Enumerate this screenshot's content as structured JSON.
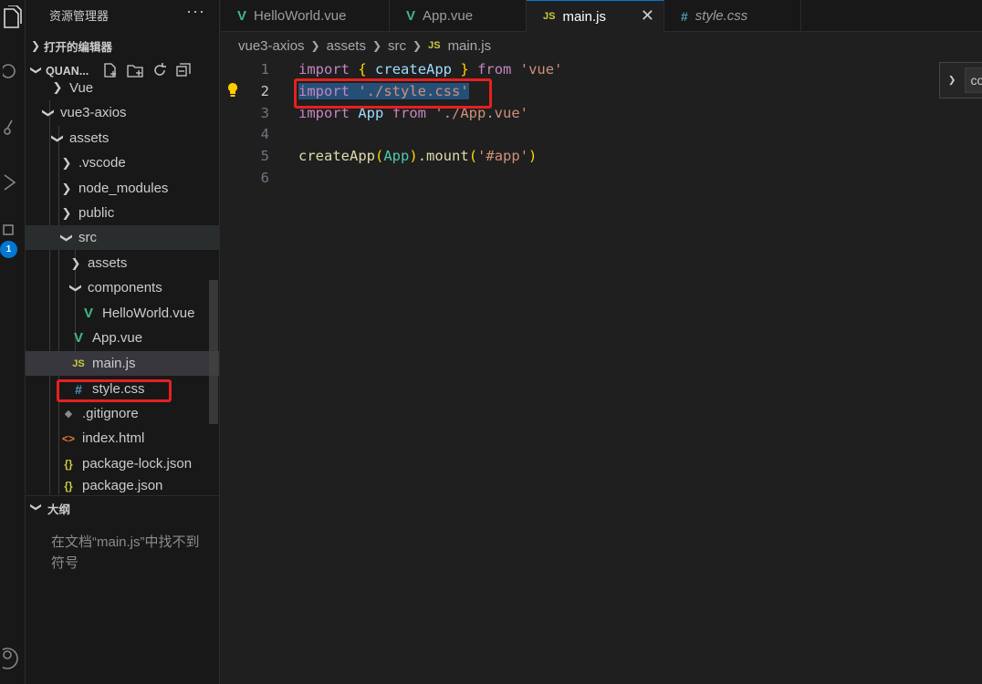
{
  "explorer": {
    "title": "资源管理器",
    "more": "···",
    "open_editors_label": "打开的编辑器",
    "workspace_label": "QUAN...",
    "outline_label": "大纲",
    "outline_message": "在文档“main.js”中找不到符号"
  },
  "tree": [
    {
      "label": "Vue",
      "type": "folder",
      "expanded": false
    },
    {
      "label": "vue3-axios",
      "type": "folder",
      "expanded": true
    },
    {
      "label": "assets",
      "type": "folder",
      "expanded": true
    },
    {
      "label": ".vscode",
      "type": "folder",
      "expanded": false
    },
    {
      "label": "node_modules",
      "type": "folder",
      "expanded": false
    },
    {
      "label": "public",
      "type": "folder",
      "expanded": false
    },
    {
      "label": "src",
      "type": "folder",
      "expanded": true
    },
    {
      "label": "assets",
      "type": "folder",
      "expanded": false
    },
    {
      "label": "components",
      "type": "folder",
      "expanded": true
    },
    {
      "label": "HelloWorld.vue",
      "type": "vue"
    },
    {
      "label": "App.vue",
      "type": "vue"
    },
    {
      "label": "main.js",
      "type": "js",
      "selected": true
    },
    {
      "label": "style.css",
      "type": "css"
    },
    {
      "label": ".gitignore",
      "type": "git"
    },
    {
      "label": "index.html",
      "type": "html"
    },
    {
      "label": "package-lock.json",
      "type": "json"
    },
    {
      "label": "package.json",
      "type": "json"
    }
  ],
  "tabs": [
    {
      "label": "HelloWorld.vue",
      "icon": "vue-icon"
    },
    {
      "label": "App.vue",
      "icon": "vue-icon"
    },
    {
      "label": "main.js",
      "icon": "js-icon",
      "active": true,
      "close": "✕"
    },
    {
      "label": "style.css",
      "icon": "css-icon"
    }
  ],
  "breadcrumb": [
    "vue3-axios",
    "assets",
    "src",
    "main.js"
  ],
  "editor": {
    "line_numbers": [
      "1",
      "2",
      "3",
      "4",
      "5",
      "6"
    ],
    "current_line": 2,
    "lines": [
      "import { createApp } from 'vue'",
      "import './style.css'",
      "import App from './App.vue'",
      "",
      "createApp(App).mount('#app')",
      ""
    ],
    "tokens": {
      "import": "import",
      "lbrace": "{",
      "createApp": "createApp",
      "rbrace": "}",
      "from": "from",
      "vue_str": "'vue'",
      "style_str": "'./style.css'",
      "App": "App",
      "app_str": "'./App.vue'",
      "lparen": "(",
      "rparen": ")",
      "dot_mount": ".mount",
      "mount_arg": "'#app'"
    },
    "suggest_text": "co"
  },
  "activity_badge": "1",
  "colors": {
    "accent": "#0078d4",
    "highlight_box": "#e62020",
    "vue_green": "#41b883",
    "js_yellow": "#cbcb41",
    "css_blue": "#519aba"
  }
}
